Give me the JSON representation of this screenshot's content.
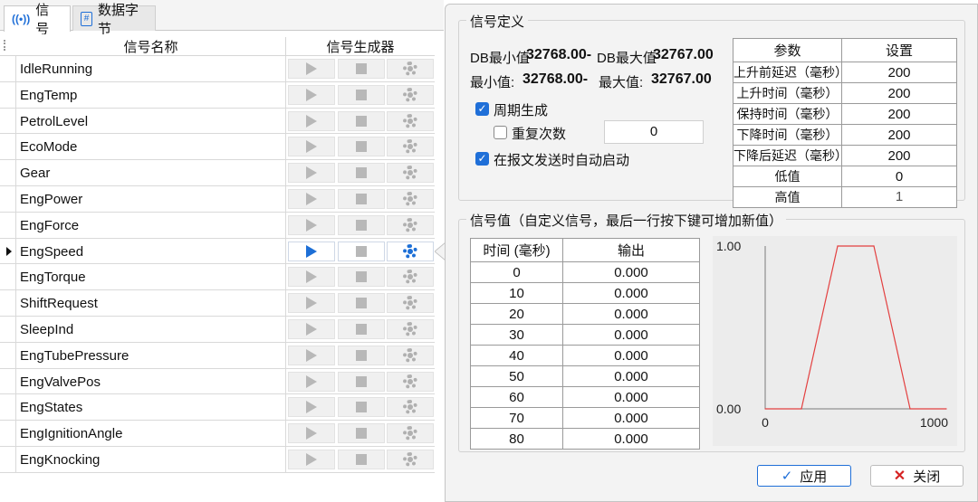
{
  "tabs": [
    {
      "label": "信号",
      "icon": "signal-icon"
    },
    {
      "label": "数据字节",
      "icon": "hash-icon"
    }
  ],
  "grid": {
    "col_name": "信号名称",
    "col_generator": "信号生成器",
    "rows": [
      "IdleRunning",
      "EngTemp",
      "PetrolLevel",
      "EcoMode",
      "Gear",
      "EngPower",
      "EngForce",
      "EngSpeed",
      "EngTorque",
      "ShiftRequest",
      "SleepInd",
      "EngTubePressure",
      "EngValvePos",
      "EngStates",
      "EngIgnitionAngle",
      "EngKnocking"
    ],
    "current_row": "EngSpeed"
  },
  "definition": {
    "title": "信号定义",
    "db_min_label": "DB最小值",
    "db_min_value": "-32768.00",
    "db_max_label": "DB最大值",
    "db_max_value": "32767.00",
    "min_label": "最小值:",
    "min_value": "-32768.00",
    "max_label": "最大值:",
    "max_value": "32767.00",
    "periodic_label": "周期生成",
    "periodic_checked": true,
    "repeat_label": "重复次数",
    "repeat_checked": false,
    "repeat_value": "0",
    "autostart_label": "在报文发送时自动启动",
    "autostart_checked": true,
    "params_header": [
      "参数",
      "设置"
    ],
    "params": [
      {
        "name": "上升前延迟（毫秒）",
        "value": "200"
      },
      {
        "name": "上升时间（毫秒）",
        "value": "200"
      },
      {
        "name": "保持时间（毫秒）",
        "value": "200"
      },
      {
        "name": "下降时间（毫秒）",
        "value": "200"
      },
      {
        "name": "下降后延迟（毫秒）",
        "value": "200"
      },
      {
        "name": "低值",
        "value": "0"
      },
      {
        "name": "高值",
        "value": "1"
      }
    ]
  },
  "values": {
    "title": "信号值（自定义信号，最后一行按下键可增加新值）",
    "header": [
      "时间 (毫秒)",
      "输出"
    ],
    "rows": [
      {
        "t": "0",
        "out": "0.000"
      },
      {
        "t": "10",
        "out": "0.000"
      },
      {
        "t": "20",
        "out": "0.000"
      },
      {
        "t": "30",
        "out": "0.000"
      },
      {
        "t": "40",
        "out": "0.000"
      },
      {
        "t": "50",
        "out": "0.000"
      },
      {
        "t": "60",
        "out": "0.000"
      },
      {
        "t": "70",
        "out": "0.000"
      },
      {
        "t": "80",
        "out": "0.000"
      }
    ]
  },
  "chart_data": {
    "type": "line",
    "title": "",
    "xlabel": "",
    "ylabel": "",
    "xlim": [
      0,
      1000
    ],
    "ylim": [
      0,
      1
    ],
    "x_ticks": [
      "0",
      "1000"
    ],
    "y_ticks": [
      "1.00",
      "0.00"
    ],
    "series": [
      {
        "color": "#e34040",
        "x": [
          0,
          200,
          400,
          600,
          800,
          1000
        ],
        "y": [
          0,
          0,
          1,
          1,
          0,
          0
        ]
      }
    ]
  },
  "buttons": {
    "apply": "应用",
    "close": "关闭"
  },
  "colors": {
    "accent": "#1f6fd8",
    "danger": "#d62323",
    "line": "#e34040"
  }
}
